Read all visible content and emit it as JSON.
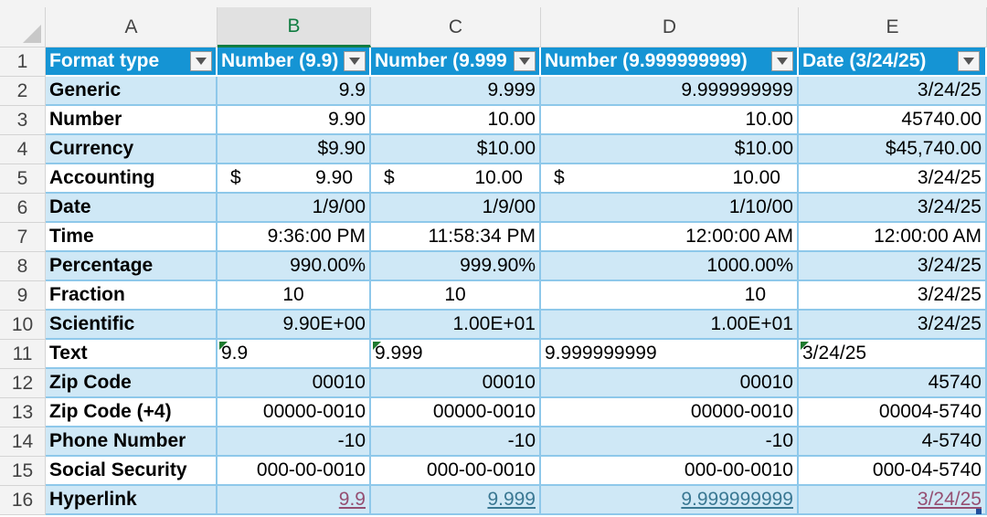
{
  "columns": [
    "A",
    "B",
    "C",
    "D",
    "E"
  ],
  "selected_column": "B",
  "row_numbers": [
    "1",
    "2",
    "3",
    "4",
    "5",
    "6",
    "7",
    "8",
    "9",
    "10",
    "11",
    "12",
    "13",
    "14",
    "15",
    "16"
  ],
  "headers": [
    "Format type",
    "Number (9.9)",
    "Number (9.999",
    "Number (9.999999999)",
    "Date (3/24/25)"
  ],
  "rows": [
    {
      "label": "Generic",
      "b": "9.9",
      "c": "9.999",
      "d": "9.999999999",
      "e": "3/24/25"
    },
    {
      "label": "Number",
      "b": "9.90",
      "c": "10.00",
      "d": "10.00",
      "e": "45740.00"
    },
    {
      "label": "Currency",
      "b": "$9.90",
      "c": "$10.00",
      "d": "$10.00",
      "e": "$45,740.00"
    },
    {
      "label": "Accounting",
      "b_sym": "$",
      "b": "9.90",
      "c_sym": "$",
      "c": "10.00",
      "d_sym": "$",
      "d": "10.00",
      "e": "3/24/25"
    },
    {
      "label": "Date",
      "b": "1/9/00",
      "c": "1/9/00",
      "d": "1/10/00",
      "e": "3/24/25"
    },
    {
      "label": "Time",
      "b": "9:36:00 PM",
      "c": "11:58:34 PM",
      "d": "12:00:00 AM",
      "e": "12:00:00 AM"
    },
    {
      "label": "Percentage",
      "b": "990.00%",
      "c": "999.90%",
      "d": "1000.00%",
      "e": "3/24/25"
    },
    {
      "label": "Fraction",
      "b": "10",
      "c": "10",
      "d": "10",
      "e": "3/24/25"
    },
    {
      "label": "Scientific",
      "b": "9.90E+00",
      "c": "1.00E+01",
      "d": "1.00E+01",
      "e": "3/24/25"
    },
    {
      "label": "Text",
      "b": "9.9",
      "c": "9.999",
      "d": "9.999999999",
      "e": "3/24/25"
    },
    {
      "label": "Zip Code",
      "b": "00010",
      "c": "00010",
      "d": "00010",
      "e": "45740"
    },
    {
      "label": "Zip Code (+4)",
      "b": "00000-0010",
      "c": "00000-0010",
      "d": "00000-0010",
      "e": "00004-5740"
    },
    {
      "label": "Phone Number",
      "b": "-10",
      "c": "-10",
      "d": "-10",
      "e": "4-5740"
    },
    {
      "label": "Social Security",
      "b": "000-00-0010",
      "c": "000-00-0010",
      "d": "000-00-0010",
      "e": "000-04-5740"
    },
    {
      "label": "Hyperlink",
      "b": "9.9",
      "c": "9.999",
      "d": "9.999999999",
      "e": "3/24/25"
    }
  ],
  "colors": {
    "header_fill": "#1594d4",
    "band_fill": "#cfe8f6",
    "grid_line": "#8ec8ea",
    "selected_column_accent": "#107c41",
    "visited_link": "#954f72",
    "link": "#3a7893",
    "text_error_indicator": "#1e7a2e"
  },
  "icons": {
    "filter": "filter-dropdown-icon",
    "error_indicator": "number-stored-as-text-indicator"
  }
}
